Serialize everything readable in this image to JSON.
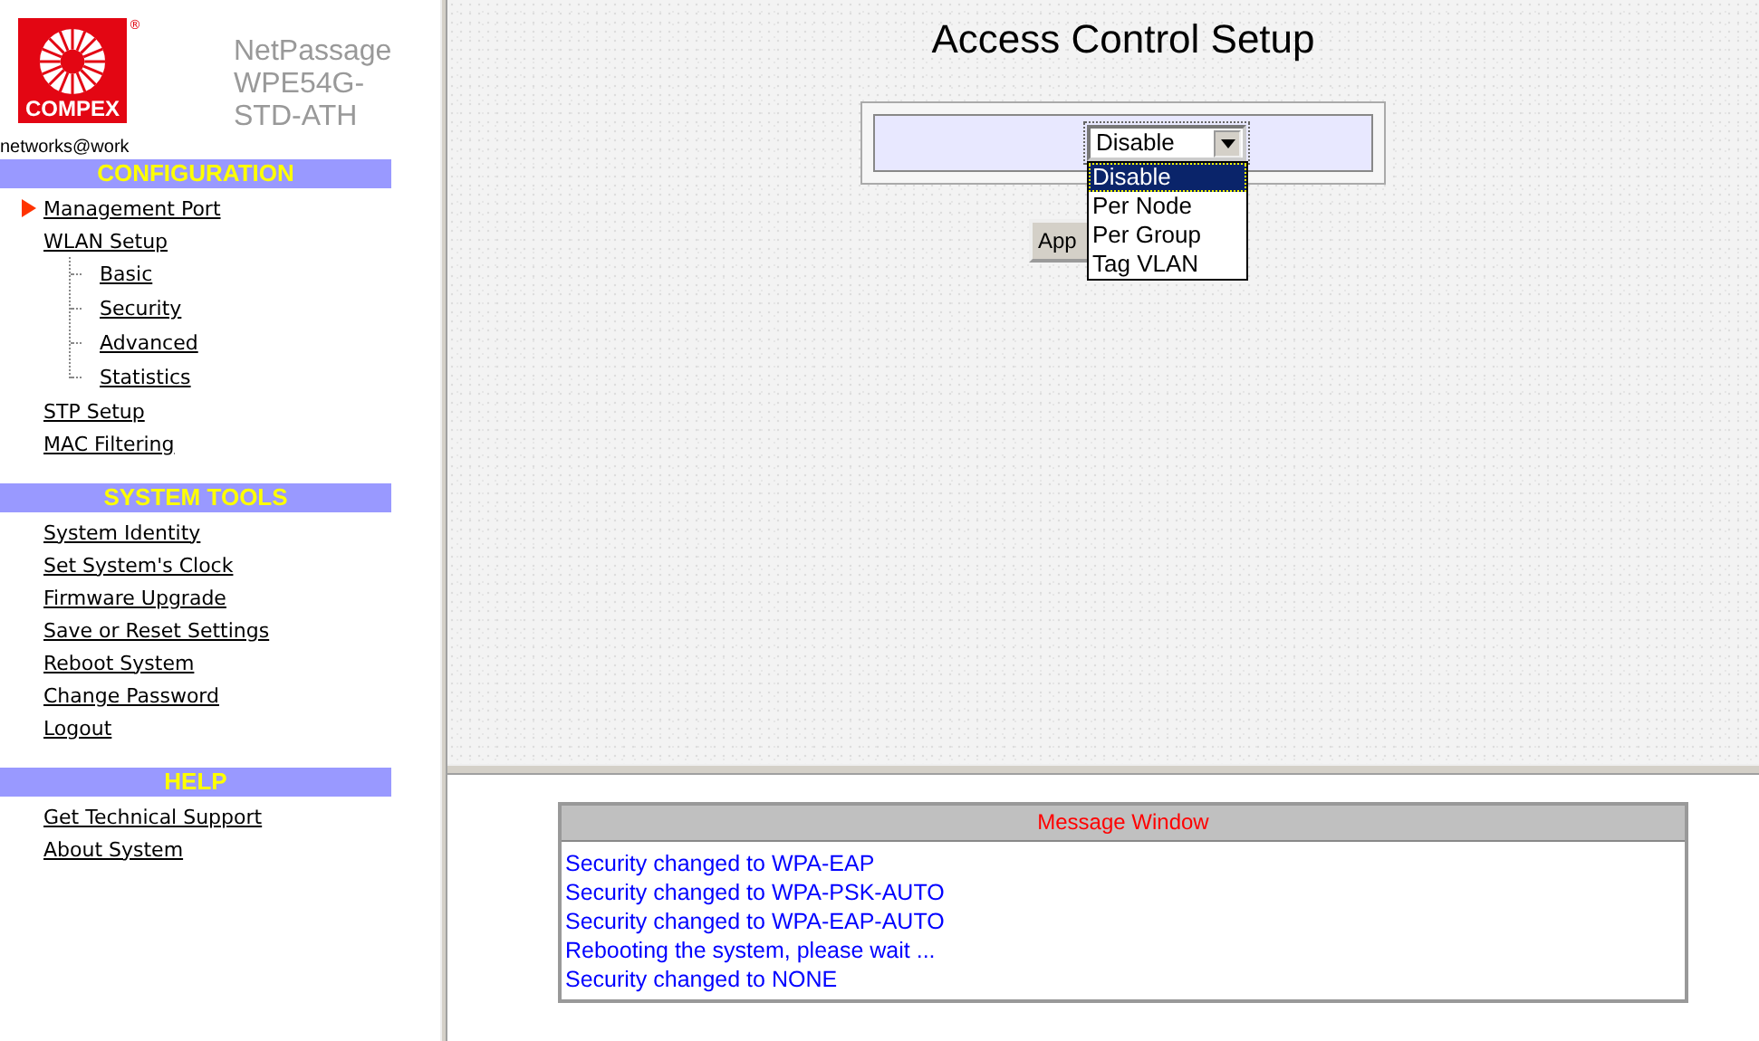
{
  "logo": {
    "text": "COMPEX",
    "mark": "®",
    "tagline": "networks@work"
  },
  "product": {
    "lines": [
      "NetPassage",
      "WPE54G-",
      "STD-ATH"
    ]
  },
  "sidebar": {
    "sections": [
      {
        "title": "CONFIGURATION",
        "items": [
          {
            "label": "Management Port",
            "selected": true
          },
          {
            "label": "WLAN Setup",
            "selected": false,
            "children": [
              {
                "label": "Basic",
                "selected": false
              },
              {
                "label": "Security",
                "selected": false
              },
              {
                "label": "Advanced",
                "selected": false
              },
              {
                "label": "Statistics",
                "selected": false
              }
            ]
          },
          {
            "label": "STP Setup",
            "selected": false
          },
          {
            "label": "MAC Filtering",
            "selected": false
          }
        ]
      },
      {
        "title": "SYSTEM TOOLS",
        "items": [
          {
            "label": "System Identity",
            "selected": false
          },
          {
            "label": "Set System's Clock",
            "selected": false
          },
          {
            "label": "Firmware Upgrade",
            "selected": false
          },
          {
            "label": "Save or Reset Settings",
            "selected": false
          },
          {
            "label": "Reboot System",
            "selected": false
          },
          {
            "label": "Change Password",
            "selected": false
          },
          {
            "label": "Logout",
            "selected": false
          }
        ]
      },
      {
        "title": "HELP",
        "items": [
          {
            "label": "Get Technical Support",
            "selected": false
          },
          {
            "label": "About System",
            "selected": false
          }
        ]
      }
    ]
  },
  "main": {
    "title": "Access Control Setup",
    "select": {
      "value": "Disable",
      "expanded": true,
      "options": [
        {
          "label": "Disable",
          "selected": true
        },
        {
          "label": "Per Node",
          "selected": false
        },
        {
          "label": "Per Group",
          "selected": false
        },
        {
          "label": "Tag VLAN",
          "selected": false
        }
      ]
    },
    "apply_button": "App"
  },
  "message_window": {
    "title": "Message Window",
    "messages": [
      "Security changed to WPA-EAP",
      "Security changed to WPA-PSK-AUTO",
      "Security changed to WPA-EAP-AUTO",
      "Rebooting the system, please wait ...",
      "Security changed to NONE"
    ]
  }
}
